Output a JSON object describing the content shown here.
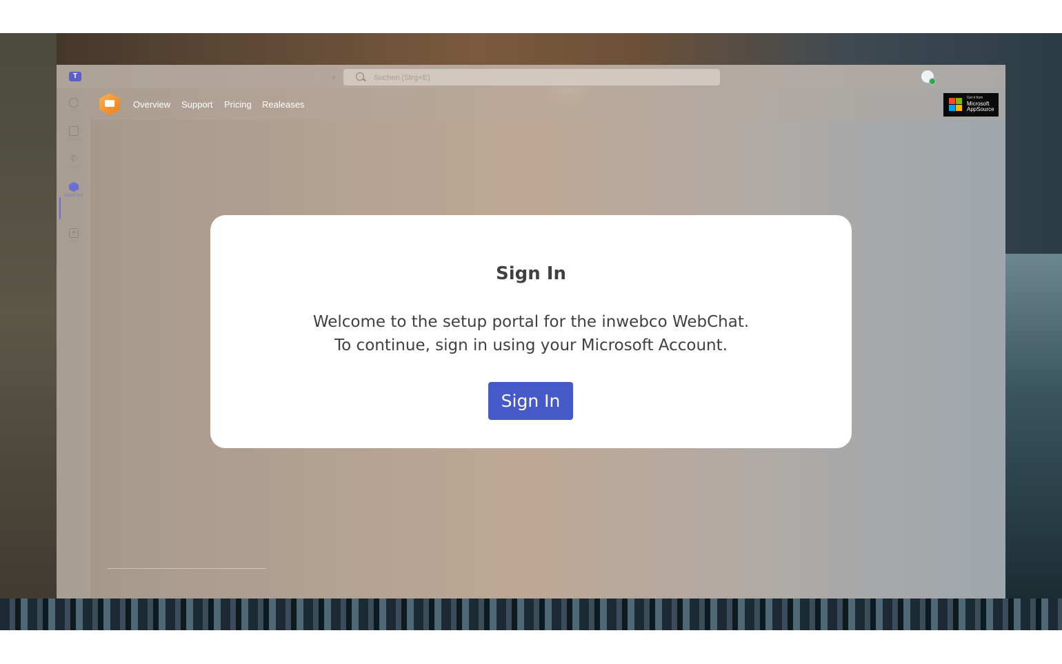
{
  "titlebar": {
    "search_placeholder": "Suchen (Strg+E)",
    "back_icon": "chevron-left-icon",
    "forward_icon": "chevron-right-icon"
  },
  "rail": {
    "items": [
      {
        "label": "Chat",
        "icon": "chat-icon"
      },
      {
        "label": "Kalender",
        "icon": "calendar-icon"
      },
      {
        "label": "Anrufe",
        "icon": "phone-icon"
      },
      {
        "label": "WebChat",
        "icon": "webchat-app-icon"
      },
      {
        "label": "Apps",
        "icon": "add-apps-icon"
      }
    ],
    "more": "···"
  },
  "app_header": {
    "nav": [
      "Overview",
      "Support",
      "Pricing",
      "Realeases"
    ],
    "badge": {
      "line1": "Get it from",
      "line2": "Microsoft",
      "line3": "AppSource"
    }
  },
  "dialog": {
    "title": "Sign In",
    "line1": "Welcome to the setup portal for the inwebco WebChat.",
    "line2": "To continue, sign in using your Microsoft Account.",
    "button": "Sign In"
  },
  "colors": {
    "accent": "#4659c8",
    "teams_purple": "#5b5fc7",
    "logo_orange": "#ef7d1c",
    "presence_green": "#2fa84f"
  }
}
